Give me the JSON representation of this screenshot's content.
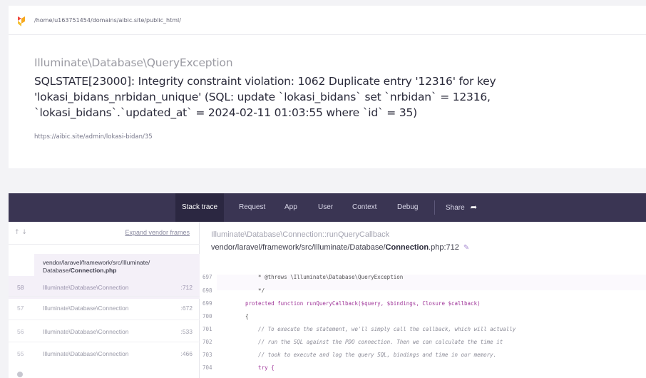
{
  "path": "/home/u163751454/domains/aibic.site/public_html/",
  "exception": {
    "class": "Illuminate\\Database\\QueryException",
    "message_lines": [
      "SQLSTATE[23000]: Integrity constraint violation: 1062 Duplicate entry '12316' for key",
      "'lokasi_bidans_nrbidan_unique' (SQL: update `lokasi_bidans` set `nrbidan` = 12316,",
      "`lokasi_bidans`.`updated_at` = 2024-02-11 01:03:55 where `id` = 35)"
    ],
    "url": "https://aibic.site/admin/lokasi-bidan/35"
  },
  "tabs": {
    "stack_trace": "Stack trace",
    "request": "Request",
    "app": "App",
    "user": "User",
    "context": "Context",
    "debug": "Debug",
    "share": "Share"
  },
  "stack": {
    "arrows": "↑ ↓",
    "expand_label": "Expand vendor frames",
    "active_file_dir": "vendor/laravel/framework/src/Illuminate/",
    "active_file_sub": "Database/",
    "active_file_name": "Connection.php",
    "frames": [
      {
        "num": "58",
        "cls": "Illuminate\\Database\\Connection",
        "line": ":712"
      },
      {
        "num": "57",
        "cls": "Illuminate\\Database\\Connection",
        "line": ":672"
      },
      {
        "num": "56",
        "cls": "Illuminate\\Database\\Connection",
        "line": ":533"
      },
      {
        "num": "55",
        "cls": "Illuminate\\Database\\Connection",
        "line": ":466"
      }
    ]
  },
  "code": {
    "class_method": "Illuminate\\Database\\Connection::runQueryCallback",
    "file_path": "vendor/laravel/framework/src/Illuminate/Database/",
    "file_name": "Connection",
    "file_ext_line": ".php:712",
    "line_numbers": [
      "697",
      "698",
      "699",
      "700",
      "701",
      "702",
      "703",
      "704"
    ],
    "lines": [
      "    * @throws \\Illuminate\\Database\\QueryException",
      "    */",
      "protected function runQueryCallback($query, $bindings, Closure $callback)",
      "{",
      "    // To execute the statement, we'll simply call the callback, which will actually",
      "    // run the SQL against the PDO connection. Then we can calculate the time it",
      "    // took to execute and log the query SQL, bindings and time in our memory.",
      "    try {"
    ]
  },
  "colors": {
    "tabbar_bg": "#3a3553",
    "tab_active_bg": "#2b2741",
    "frame_selected_bg": "#f4f0f8",
    "accent": "#a78bd1"
  }
}
